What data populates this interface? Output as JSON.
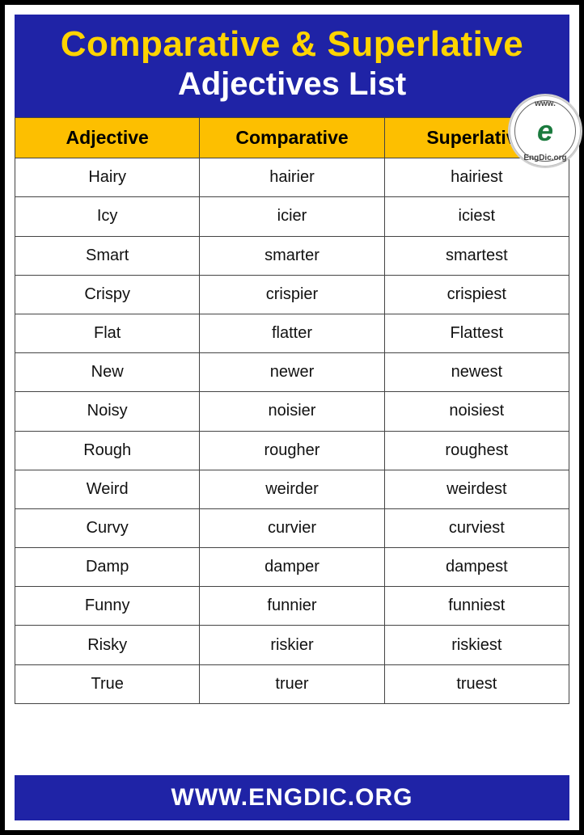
{
  "header": {
    "title": "Comparative & Superlative",
    "subtitle": "Adjectives List"
  },
  "logo": {
    "top_text": "www.",
    "bottom_text": "EngDic.org",
    "glyph": "e"
  },
  "columns": {
    "c0": "Adjective",
    "c1": "Comparative",
    "c2": "Superlative"
  },
  "chart_data": {
    "type": "table",
    "columns": [
      "Adjective",
      "Comparative",
      "Superlative"
    ],
    "rows": [
      {
        "adj": "Hairy",
        "comp": "hairier",
        "sup": "hairiest"
      },
      {
        "adj": "Icy",
        "comp": "icier",
        "sup": "iciest"
      },
      {
        "adj": "Smart",
        "comp": "smarter",
        "sup": "smartest"
      },
      {
        "adj": "Crispy",
        "comp": "crispier",
        "sup": "crispiest"
      },
      {
        "adj": "Flat",
        "comp": "flatter",
        "sup": "Flattest"
      },
      {
        "adj": "New",
        "comp": "newer",
        "sup": "newest"
      },
      {
        "adj": "Noisy",
        "comp": "noisier",
        "sup": "noisiest"
      },
      {
        "adj": "Rough",
        "comp": "rougher",
        "sup": "roughest"
      },
      {
        "adj": "Weird",
        "comp": "weirder",
        "sup": "weirdest"
      },
      {
        "adj": "Curvy",
        "comp": "curvier",
        "sup": "curviest"
      },
      {
        "adj": "Damp",
        "comp": "damper",
        "sup": "dampest"
      },
      {
        "adj": "Funny",
        "comp": "funnier",
        "sup": "funniest"
      },
      {
        "adj": "Risky",
        "comp": "riskier",
        "sup": "riskiest"
      },
      {
        "adj": "True",
        "comp": "truer",
        "sup": "truest"
      }
    ]
  },
  "footer": {
    "text": "WWW.ENGDIC.ORG"
  }
}
